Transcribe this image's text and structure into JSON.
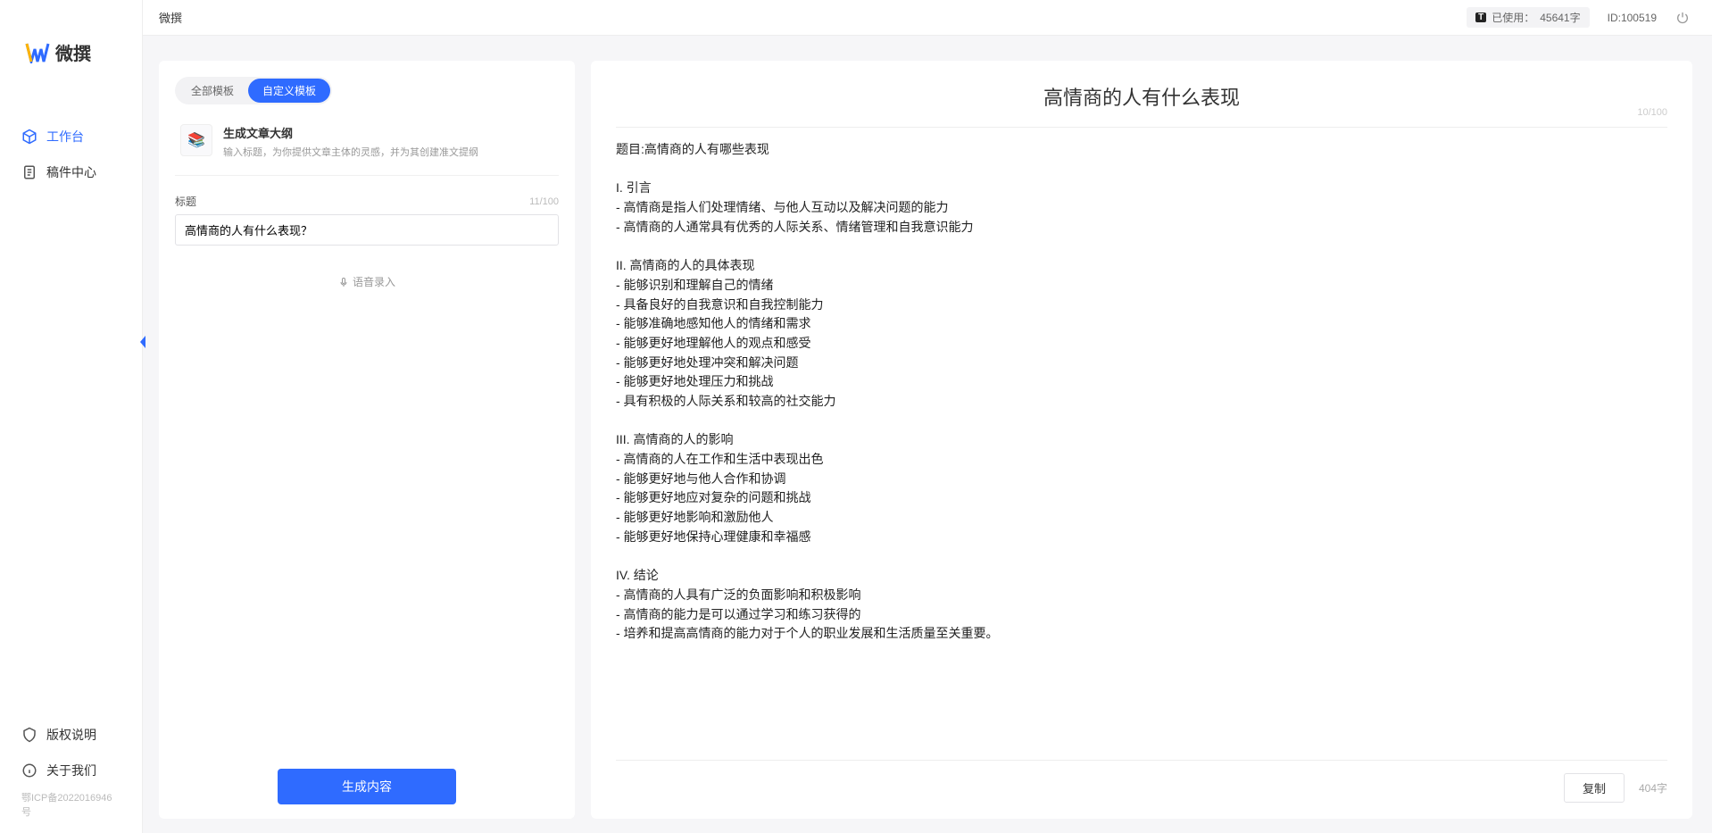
{
  "app": {
    "logo_text": "微撰",
    "breadcrumb": "微撰",
    "usage_label": "已使用：",
    "usage_value": "45641字",
    "user_id_label": "ID:100519",
    "usage_badge": "T"
  },
  "sidebar": {
    "items": [
      {
        "label": "工作台",
        "icon": "cube"
      },
      {
        "label": "稿件中心",
        "icon": "doc"
      }
    ],
    "footer": [
      {
        "label": "版权说明",
        "icon": "shield"
      },
      {
        "label": "关于我们",
        "icon": "info"
      }
    ],
    "icp": "鄂ICP备2022016946号"
  },
  "tabs": {
    "all": "全部模板",
    "custom": "自定义模板"
  },
  "template": {
    "icon": "📚",
    "title": "生成文章大纲",
    "desc": "输入标题，为你提供文章主体的灵感，并为其创建准文提纲"
  },
  "form": {
    "title_label": "标题",
    "title_count": "11/100",
    "title_value": "高情商的人有什么表现？",
    "voice_hint": "语音录入",
    "generate_label": "生成内容"
  },
  "result": {
    "title": "高情商的人有什么表现",
    "title_count": "10/100",
    "body": "题目:高情商的人有哪些表现\n\nI. 引言\n- 高情商是指人们处理情绪、与他人互动以及解决问题的能力\n- 高情商的人通常具有优秀的人际关系、情绪管理和自我意识能力\n\nII. 高情商的人的具体表现\n- 能够识别和理解自己的情绪\n- 具备良好的自我意识和自我控制能力\n- 能够准确地感知他人的情绪和需求\n- 能够更好地理解他人的观点和感受\n- 能够更好地处理冲突和解决问题\n- 能够更好地处理压力和挑战\n- 具有积极的人际关系和较高的社交能力\n\nIII. 高情商的人的影响\n- 高情商的人在工作和生活中表现出色\n- 能够更好地与他人合作和协调\n- 能够更好地应对复杂的问题和挑战\n- 能够更好地影响和激励他人\n- 能够更好地保持心理健康和幸福感\n\nIV. 结论\n- 高情商的人具有广泛的负面影响和积极影响\n- 高情商的能力是可以通过学习和练习获得的\n- 培养和提高高情商的能力对于个人的职业发展和生活质量至关重要。",
    "copy_label": "复制",
    "word_count": "404字"
  }
}
